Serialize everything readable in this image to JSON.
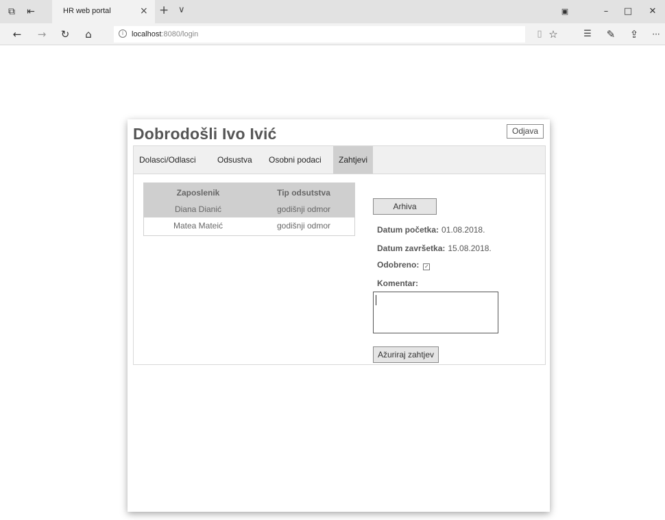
{
  "browser": {
    "tab_title": "HR web portal",
    "address_host": "localhost",
    "address_path": ":8080/login",
    "icons": {
      "tab_manager": "tabs-icon",
      "set_aside": "set-aside-icon",
      "close_tab": "×",
      "new_tab": "+",
      "tab_list": "∨",
      "back": "←",
      "forward": "→",
      "refresh": "↻",
      "home": "⌂",
      "reading_view": "▯",
      "favorite": "☆",
      "favorites_hub": "☰",
      "notes": "✎",
      "share": "⇪",
      "more": "···",
      "minimize": "–",
      "maximize": "□",
      "close": "✕"
    }
  },
  "app": {
    "greeting": "Dobrodošli Ivo Ivić",
    "logout_label": "Odjava",
    "tabs": [
      {
        "label": "Dolasci/Odlasci"
      },
      {
        "label": "Odsustva"
      },
      {
        "label": "Osobni podaci"
      },
      {
        "label": "Zahtjevi"
      }
    ],
    "active_tab": "Zahtjevi",
    "table": {
      "headers": [
        "Zaposlenik",
        "Tip odsutstva"
      ],
      "rows": [
        {
          "employee": "Diana Dianić",
          "type": "godišnji odmor",
          "selected": true
        },
        {
          "employee": "Matea Mateić",
          "type": "godišnji odmor",
          "selected": false
        }
      ]
    },
    "details": {
      "archive_label": "Arhiva",
      "start_label": "Datum početka:",
      "start_value": "01.08.2018.",
      "end_label": "Datum završetka:",
      "end_value": "15.08.2018.",
      "approved_label": "Odobreno:",
      "approved_value": true,
      "comment_label": "Komentar:",
      "comment_value": "",
      "update_label": "Ažuriraj zahtjev"
    }
  }
}
